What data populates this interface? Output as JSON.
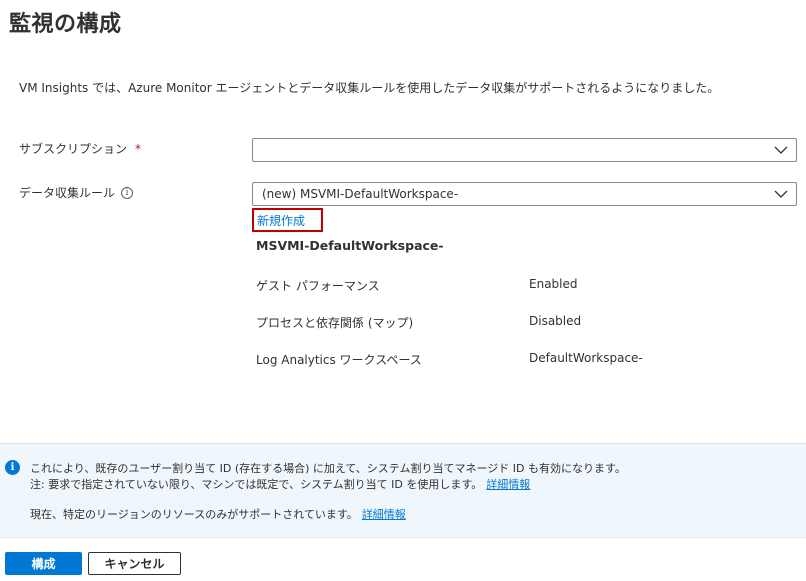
{
  "page": {
    "title": "監視の構成",
    "intro": "VM Insights では、Azure Monitor エージェントとデータ収集ルールを使用したデータ収集がサポートされるようになりました。"
  },
  "form": {
    "subscription": {
      "label": "サブスクリプション",
      "required_mark": "*",
      "value": ""
    },
    "dcr": {
      "label": "データ収集ルール",
      "info_icon": "info-icon",
      "value": "(new) MSVMI-DefaultWorkspace-",
      "create_new_label": "新規作成"
    }
  },
  "rule_details": {
    "name": "MSVMI-DefaultWorkspace-",
    "rows": [
      {
        "key": "ゲスト パフォーマンス",
        "value": "Enabled"
      },
      {
        "key": "プロセスと依存関係 (マップ)",
        "value": "Disabled"
      },
      {
        "key": "Log Analytics ワークスペース",
        "value": "DefaultWorkspace-"
      }
    ]
  },
  "info_banner": {
    "line1": "これにより、既存のユーザー割り当て ID (存在する場合) に加えて、システム割り当てマネージド ID も有効になります。",
    "line2": "注: 要求で指定されていない限り、マシンでは既定で、システム割り当て ID を使用します。",
    "line2_link": "詳細情報",
    "line3": "現在、特定のリージョンのリソースのみがサポートされています。",
    "line3_link": "詳細情報"
  },
  "footer": {
    "configure_label": "構成",
    "cancel_label": "キャンセル"
  },
  "colors": {
    "primary": "#0078d4",
    "highlight_border": "#c00000",
    "banner_bg": "#eff6fc",
    "required": "#a4262c"
  }
}
